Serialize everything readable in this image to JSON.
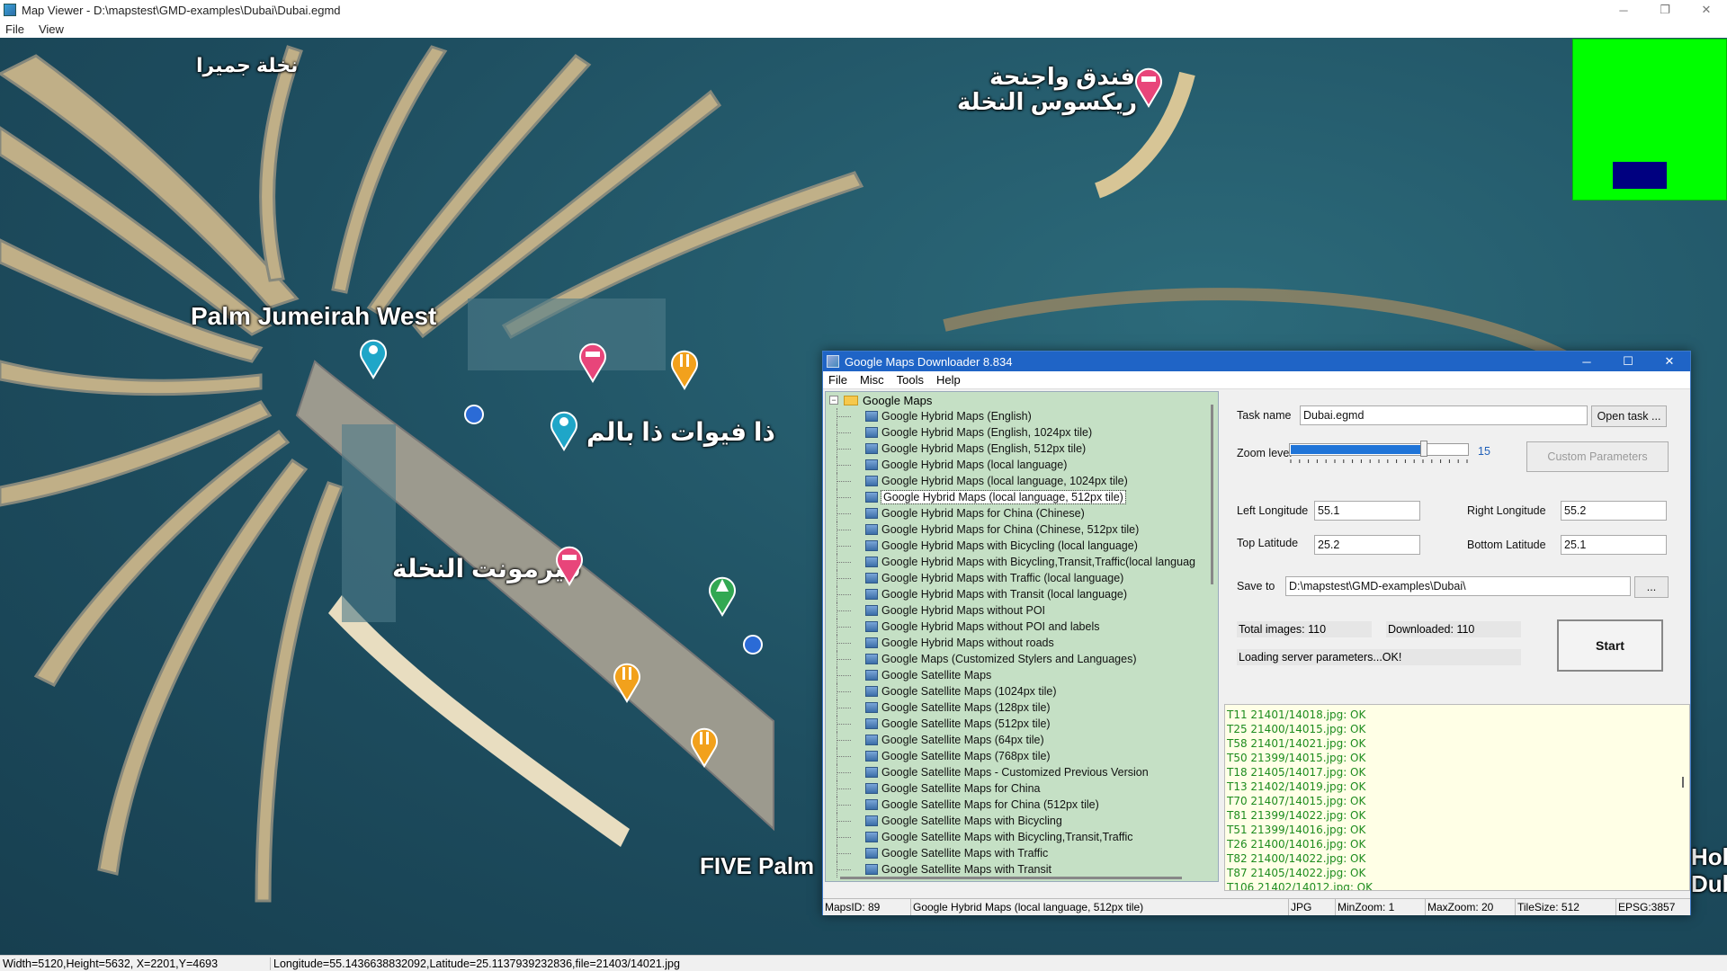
{
  "app": {
    "title": "Map Viewer - D:\\mapstest\\GMD-examples\\Dubai\\Dubai.egmd",
    "menu": [
      "File",
      "View"
    ],
    "window_controls": [
      "─",
      "❐",
      "✕"
    ]
  },
  "map": {
    "labels": [
      {
        "text": "نخلة جميرا"
      },
      {
        "text": "فندق واجنحة"
      },
      {
        "text": "ريكسوس النخلة"
      },
      {
        "text": "Palm Jumeirah West"
      },
      {
        "text": "ذا فيوات ذا بالم"
      },
      {
        "text": "فيرمونت النخلة"
      },
      {
        "text": "FIVE Palm"
      },
      {
        "text": "Hol"
      },
      {
        "text": "Dub"
      }
    ],
    "overview_colors": {
      "background": "#00ff00",
      "viewport": "#000080"
    }
  },
  "dialog": {
    "title": "Google Maps Downloader 8.834",
    "menu": [
      "File",
      "Misc",
      "Tools",
      "Help"
    ],
    "controls": [
      "─",
      "☐",
      "✕"
    ],
    "tree": {
      "root_label": "Google Maps",
      "items": [
        "Google Hybrid Maps (English)",
        "Google Hybrid Maps (English, 1024px tile)",
        "Google Hybrid Maps (English, 512px tile)",
        "Google Hybrid Maps (local language)",
        "Google Hybrid Maps (local language, 1024px tile)",
        "Google Hybrid Maps (local language, 512px tile)",
        "Google Hybrid Maps for China (Chinese)",
        "Google Hybrid Maps for China (Chinese, 512px tile)",
        "Google Hybrid Maps with Bicycling (local language)",
        "Google Hybrid Maps with Bicycling,Transit,Traffic(local languag",
        "Google Hybrid Maps with Traffic (local language)",
        "Google Hybrid Maps with Transit (local language)",
        "Google Hybrid Maps without POI",
        "Google Hybrid Maps without POI and labels",
        "Google Hybrid Maps without roads",
        "Google Maps (Customized Stylers and Languages)",
        "Google Satellite Maps",
        "Google Satellite Maps (1024px tile)",
        "Google Satellite Maps (128px tile)",
        "Google Satellite Maps (512px tile)",
        "Google Satellite Maps (64px tile)",
        "Google Satellite Maps (768px tile)",
        "Google Satellite Maps - Customized Previous Version",
        "Google Satellite Maps for China",
        "Google Satellite Maps for China (512px tile)",
        "Google Satellite Maps with Bicycling",
        "Google Satellite Maps with Bicycling,Transit,Traffic",
        "Google Satellite Maps with Traffic",
        "Google Satellite Maps with Transit"
      ],
      "selected_index": 5
    },
    "form": {
      "task_name_label": "Task name",
      "task_name_value": "Dubai.egmd",
      "open_task_label": "Open task ...",
      "zoom_label": "Zoom level",
      "zoom_value": "15",
      "zoom_fraction": 0.75,
      "custom_params_label": "Custom Parameters",
      "left_lon_label": "Left Longitude",
      "left_lon_value": "55.1",
      "right_lon_label": "Right Longitude",
      "right_lon_value": "55.2",
      "top_lat_label": "Top Latitude",
      "top_lat_value": "25.2",
      "bottom_lat_label": "Bottom Latitude",
      "bottom_lat_value": "25.1",
      "save_to_label": "Save to",
      "save_to_value": "D:\\mapstest\\GMD-examples\\Dubai\\",
      "browse_label": "...",
      "total_images": "Total images: 110",
      "downloaded": "Downloaded: 110",
      "loading_status": "Loading server parameters...OK!",
      "start_label": "Start"
    },
    "log": [
      "T11 21401/14018.jpg: OK",
      "T25 21400/14015.jpg: OK",
      "T58 21401/14021.jpg: OK",
      "T50 21399/14015.jpg: OK",
      "T18 21405/14017.jpg: OK",
      "T13 21402/14019.jpg: OK",
      "T70 21407/14015.jpg: OK",
      "T81 21399/14022.jpg: OK",
      "T51 21399/14016.jpg: OK",
      "T26 21400/14016.jpg: OK",
      "T82 21400/14022.jpg: OK",
      "T87 21405/14022.jpg: OK",
      "T106 21402/14012.jpg: OK"
    ],
    "log_color": "#1e8c1e",
    "status": {
      "maps_id": "MapsID: 89",
      "map_name": "Google Hybrid Maps (local language, 512px tile)",
      "format": "JPG",
      "min_zoom": "MinZoom: 1",
      "max_zoom": "MaxZoom: 20",
      "tile_size": "TileSize: 512",
      "epsg": "EPSG:3857"
    }
  },
  "statusbar": {
    "dims": "Width=5120,Height=5632, X=2201,Y=4693",
    "coords": "Longitude=55.1436638832092,Latitude=25.1137939232836,file=21403/14021.jpg"
  },
  "icons": {
    "hotel": "hotel-pin-icon",
    "restaurant": "restaurant-pin-icon",
    "camera": "camera-pin-icon",
    "park": "park-pin-icon",
    "bus": "bus-stop-icon",
    "folder": "folder-icon",
    "map_leaf": "map-type-icon"
  }
}
